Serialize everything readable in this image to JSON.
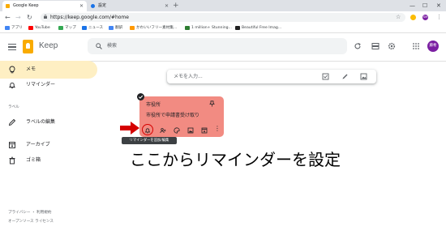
{
  "browser": {
    "tabs": [
      {
        "label": "Google Keep"
      },
      {
        "label": "設定"
      }
    ],
    "url": "https://keep.google.com/#home",
    "bookmarks": [
      {
        "label": "アプリ"
      },
      {
        "label": "YouTube"
      },
      {
        "label": "マップ"
      },
      {
        "label": "ニュース"
      },
      {
        "label": "翻訳"
      },
      {
        "label": "かわいいフリー素材集..."
      },
      {
        "label": "1 million+ Stunning..."
      },
      {
        "label": "Beautiful Free Imag..."
      }
    ],
    "profile_initials": "SM"
  },
  "header": {
    "app_name": "Keep",
    "search_placeholder": "検索",
    "avatar_text": "藤希"
  },
  "sidebar": {
    "items": [
      {
        "label": "メモ",
        "icon": "lightbulb-icon",
        "active": true
      },
      {
        "label": "リマインダー",
        "icon": "bell-icon"
      },
      {
        "label": "ラベルの編集",
        "icon": "pencil-icon"
      },
      {
        "label": "アーカイブ",
        "icon": "archive-icon"
      },
      {
        "label": "ゴミ箱",
        "icon": "trash-icon"
      }
    ],
    "section_label": "ラベル",
    "footer_links": [
      "プライバシー",
      "利用規約"
    ],
    "footer_separator": "・",
    "footer_license": "オープンソース ライセンス"
  },
  "take_note": {
    "placeholder": "メモを入力..."
  },
  "note": {
    "title": "市役所",
    "body": "市役所で申請書受け取り",
    "color": "#f28b82",
    "tooltip": "リマインダーを追加/編集"
  },
  "annotation": {
    "caption": "ここからリマインダーを設定",
    "arrow_color": "#d50000"
  }
}
